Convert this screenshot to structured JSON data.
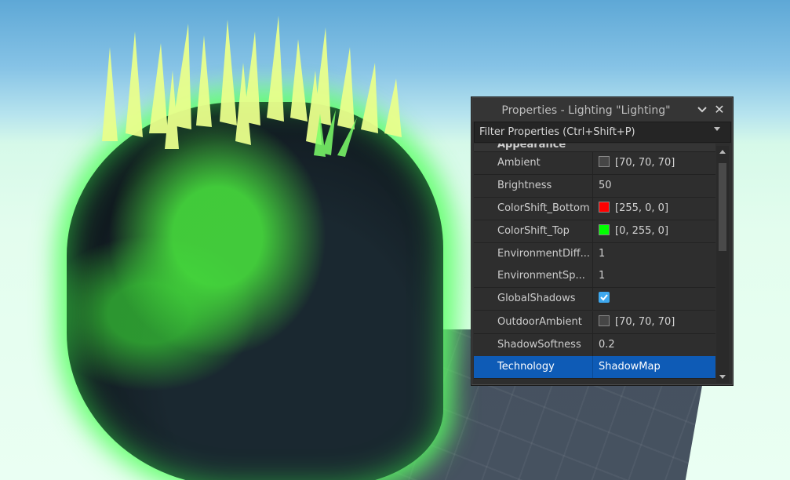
{
  "window": {
    "title": "Properties - Lighting \"Lighting\"",
    "close_glyph": "✕"
  },
  "filter": {
    "placeholder": "Filter Properties (Ctrl+Shift+P)"
  },
  "section": {
    "label": "Appearance"
  },
  "properties": [
    {
      "name": "Ambient",
      "value": "[70, 70, 70]",
      "swatch": "#464646"
    },
    {
      "name": "Brightness",
      "value": "50"
    },
    {
      "name": "ColorShift_Bottom",
      "value": "[255, 0, 0]",
      "swatch": "#ff0000"
    },
    {
      "name": "ColorShift_Top",
      "value": "[0, 255, 0]",
      "swatch": "#00ff00"
    },
    {
      "name": "EnvironmentDiff...",
      "value": "1"
    },
    {
      "name": "EnvironmentSp...",
      "value": "1"
    },
    {
      "name": "GlobalShadows",
      "value": "",
      "checked": true
    },
    {
      "name": "OutdoorAmbient",
      "value": "[70, 70, 70]",
      "swatch": "#464646"
    },
    {
      "name": "ShadowSoftness",
      "value": "0.2"
    },
    {
      "name": "Technology",
      "value": "ShadowMap",
      "selected": true
    }
  ],
  "colors": {
    "selection": "#0e5bb6",
    "checkbox": "#3ea8ee",
    "panel_bg": "#2e2e2e"
  },
  "icons": [
    "chevron-down-icon",
    "close-icon",
    "dropdown-arrow-icon",
    "checkmark-icon",
    "scroll-up-icon",
    "scroll-down-icon"
  ]
}
